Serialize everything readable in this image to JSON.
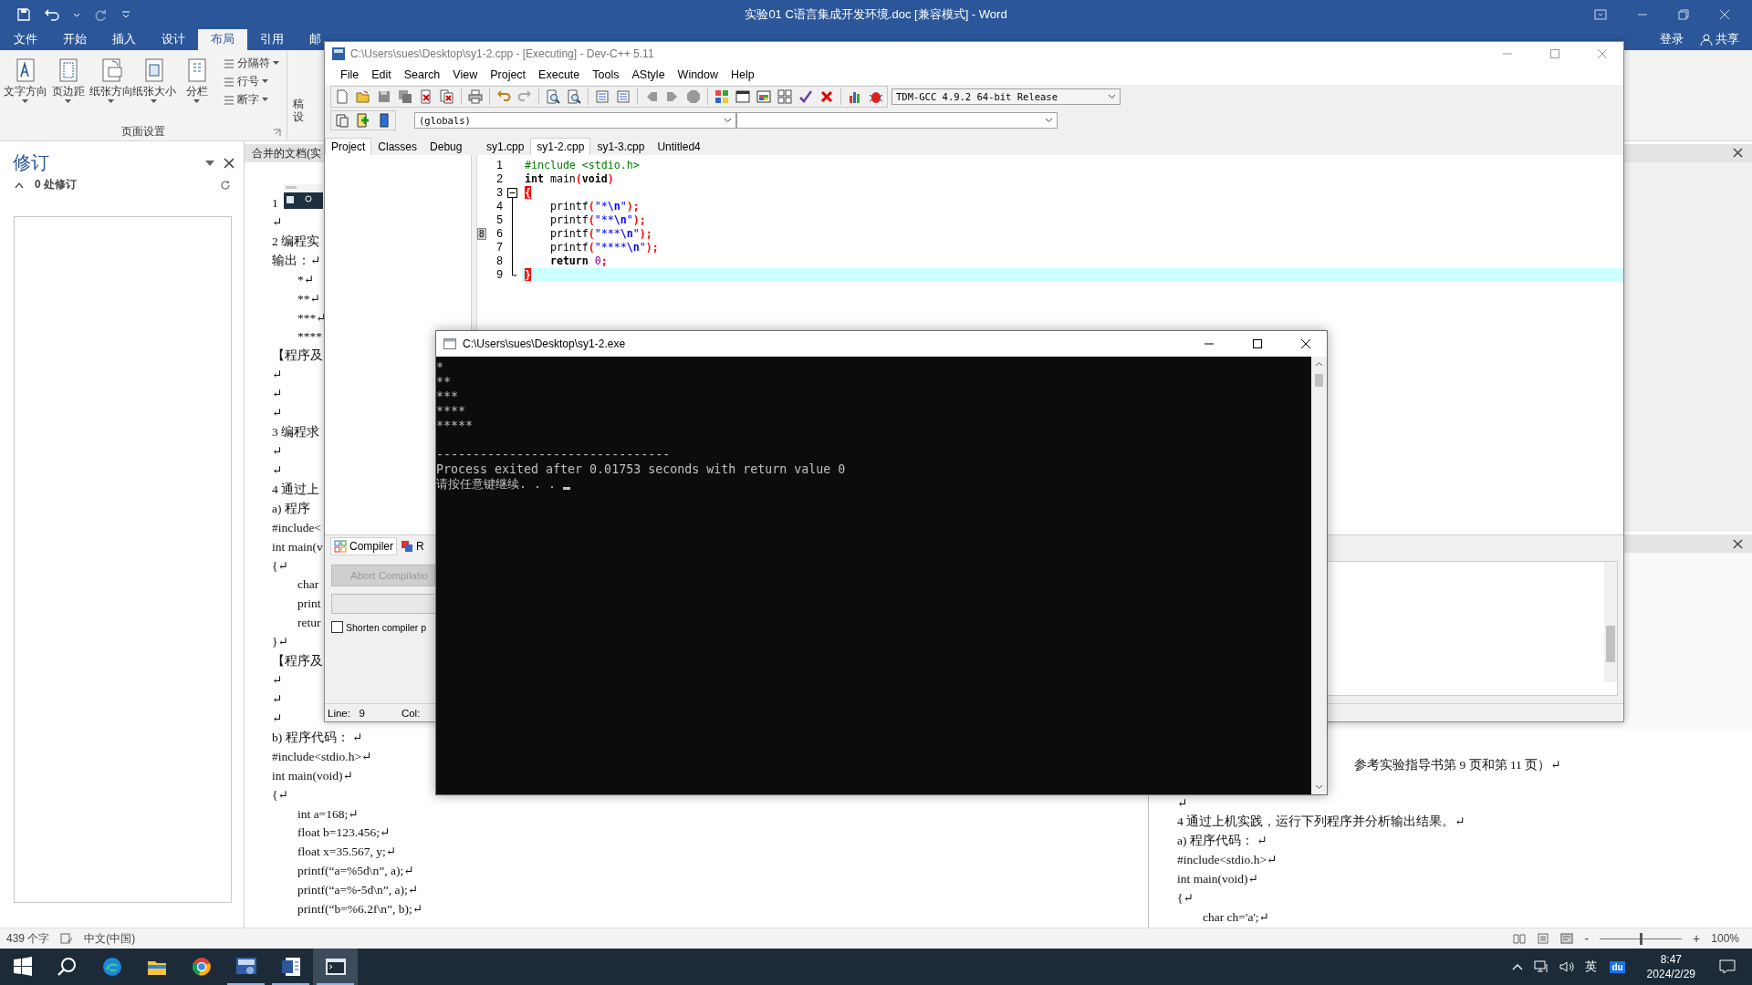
{
  "word": {
    "title": "实验01 C语言集成开发环境.doc [兼容模式] - Word",
    "ribbon_tabs": [
      {
        "label": "文件",
        "selected": false
      },
      {
        "label": "开始",
        "selected": false
      },
      {
        "label": "插入",
        "selected": false
      },
      {
        "label": "设计",
        "selected": false
      },
      {
        "label": "布局",
        "selected": true
      },
      {
        "label": "引用",
        "selected": false
      },
      {
        "label": "邮",
        "selected": false
      }
    ],
    "sign_in": "登录",
    "share": "共享",
    "large_buttons": [
      "文字方向",
      "页边距",
      "纸张方向",
      "纸张大小",
      "分栏"
    ],
    "small_buttons": [
      "分隔符",
      "行号",
      "断字"
    ],
    "group_label": "页面设置",
    "cut_labels": [
      "稿",
      "设"
    ],
    "revisions": {
      "title": "修订",
      "count": "0 处修订"
    },
    "doc_tab": "合并的文档(实",
    "left_lines": [
      {
        "text": "1",
        "indent": false
      },
      {
        "text": "↵",
        "indent": false
      },
      {
        "text": "2 编程实",
        "indent": false
      },
      {
        "text": "输出：↵",
        "indent": false
      },
      {
        "text": "*↵",
        "indent": true
      },
      {
        "text": "**↵",
        "indent": true
      },
      {
        "text": "***↵",
        "indent": true
      },
      {
        "text": "****",
        "indent": true
      },
      {
        "text": "【程序及",
        "indent": false
      },
      {
        "text": "↵",
        "indent": false
      },
      {
        "text": "↵",
        "indent": false
      },
      {
        "text": "↵",
        "indent": false
      },
      {
        "text": "3 编程求",
        "indent": false
      },
      {
        "text": "↵",
        "indent": false
      },
      {
        "text": "↵",
        "indent": false
      },
      {
        "text": "4 通过上",
        "indent": false
      },
      {
        "text": "a)  程序",
        "indent": false
      },
      {
        "text": "#include<",
        "indent": false
      },
      {
        "text": "int main(v",
        "indent": false
      },
      {
        "text": "{↵",
        "indent": false
      },
      {
        "text": "char",
        "indent": true
      },
      {
        "text": "print",
        "indent": true
      },
      {
        "text": "retur",
        "indent": true
      },
      {
        "text": "}↵",
        "indent": false
      },
      {
        "text": "【程序及",
        "indent": false
      },
      {
        "text": "↵",
        "indent": false
      },
      {
        "text": "↵",
        "indent": false
      },
      {
        "text": "↵",
        "indent": false
      },
      {
        "text": "b)    程序代码：  ↵",
        "indent": false
      },
      {
        "text": "#include<stdio.h>↵",
        "indent": false
      },
      {
        "text": "int main(void)↵",
        "indent": false
      },
      {
        "text": "{↵",
        "indent": false
      },
      {
        "text": "int a=168;↵",
        "indent": true
      },
      {
        "text": "float b=123.456;↵",
        "indent": true
      },
      {
        "text": "float x=35.567, y;↵",
        "indent": true
      },
      {
        "text": "printf(“a=%5d\\n”, a);↵",
        "indent": true
      },
      {
        "text": "printf(“a=%-5d\\n”, a);↵",
        "indent": true
      },
      {
        "text": "printf(“b=%6.2f\\n”, b);↵",
        "indent": true
      }
    ],
    "right_partial_line": "参考实验指导书第 9 页和第 11 页）↵",
    "right_lines": [
      {
        "text": "↵",
        "indent": false
      },
      {
        "text": "4 通过上机实践，运行下列程序并分析输出结果。↵",
        "indent": false
      },
      {
        "text": "a)    程序代码：  ↵",
        "indent": false
      },
      {
        "text": "#include<stdio.h>↵",
        "indent": false
      },
      {
        "text": "int main(void)↵",
        "indent": false
      },
      {
        "text": "{↵",
        "indent": false
      },
      {
        "text": "char ch='a';↵",
        "indent": true
      }
    ],
    "status": {
      "words": "439 个字",
      "language": "中文(中国)",
      "zoom_out": "-",
      "zoom_in": "+",
      "zoom": "100%",
      "level": 0.5
    }
  },
  "devcpp": {
    "title": "C:\\Users\\sues\\Desktop\\sy1-2.cpp - [Executing] - Dev-C++ 5.11",
    "menu": [
      "File",
      "Edit",
      "Search",
      "View",
      "Project",
      "Execute",
      "Tools",
      "AStyle",
      "Window",
      "Help"
    ],
    "compiler": "TDM-GCC 4.9.2 64-bit Release",
    "scope": "(globals)",
    "panel_tabs": [
      {
        "label": "Project",
        "selected": true
      },
      {
        "label": "Classes",
        "selected": false
      },
      {
        "label": "Debug",
        "selected": false
      }
    ],
    "file_tabs": [
      {
        "label": "sy1.cpp",
        "selected": false
      },
      {
        "label": "sy1-2.cpp",
        "selected": true
      },
      {
        "label": "sy1-3.cpp",
        "selected": false
      },
      {
        "label": "Untitled4",
        "selected": false
      }
    ],
    "code": [
      {
        "number": "1",
        "current": false,
        "kind": "plain",
        "tokens": [
          {
            "kind": "preprocessor",
            "text": "#include <stdio.h>"
          }
        ]
      },
      {
        "number": "2",
        "current": false,
        "kind": "plain",
        "tokens": [
          {
            "kind": "keyword",
            "text": "int"
          },
          {
            "kind": "plain",
            "text": " main"
          },
          {
            "kind": "symbol",
            "text": "("
          },
          {
            "kind": "keyword",
            "text": "void"
          },
          {
            "kind": "symbol",
            "text": ")"
          }
        ]
      },
      {
        "number": "3",
        "current": false,
        "kind": "fold-start",
        "tokens": [
          {
            "kind": "match",
            "text": "{"
          }
        ]
      },
      {
        "number": "4",
        "current": false,
        "kind": "fold-line",
        "tokens": [
          {
            "kind": "plain",
            "text": "    printf"
          },
          {
            "kind": "symbol",
            "text": "("
          },
          {
            "kind": "string",
            "text": "\"*"
          },
          {
            "kind": "escape",
            "text": "\\n"
          },
          {
            "kind": "string",
            "text": "\""
          },
          {
            "kind": "symbol",
            "text": ");"
          }
        ]
      },
      {
        "number": "5",
        "current": false,
        "kind": "fold-line",
        "tokens": [
          {
            "kind": "plain",
            "text": "    printf"
          },
          {
            "kind": "symbol",
            "text": "("
          },
          {
            "kind": "string",
            "text": "\"**"
          },
          {
            "kind": "escape",
            "text": "\\n"
          },
          {
            "kind": "string",
            "text": "\""
          },
          {
            "kind": "symbol",
            "text": ");"
          }
        ]
      },
      {
        "number": "6",
        "current": false,
        "bookmark": "8",
        "kind": "fold-line",
        "tokens": [
          {
            "kind": "plain",
            "text": "    printf"
          },
          {
            "kind": "symbol",
            "text": "("
          },
          {
            "kind": "string",
            "text": "\"***"
          },
          {
            "kind": "escape",
            "text": "\\n"
          },
          {
            "kind": "string",
            "text": "\""
          },
          {
            "kind": "symbol",
            "text": ");"
          }
        ]
      },
      {
        "number": "7",
        "current": false,
        "kind": "fold-line",
        "tokens": [
          {
            "kind": "plain",
            "text": "    printf"
          },
          {
            "kind": "symbol",
            "text": "("
          },
          {
            "kind": "string",
            "text": "\"****"
          },
          {
            "kind": "escape",
            "text": "\\n"
          },
          {
            "kind": "string",
            "text": "\""
          },
          {
            "kind": "symbol",
            "text": ");"
          }
        ]
      },
      {
        "number": "8",
        "current": false,
        "kind": "fold-line",
        "tokens": [
          {
            "kind": "keyword",
            "text": "    return"
          },
          {
            "kind": "number",
            "text": " 0"
          },
          {
            "kind": "symbol",
            "text": ";"
          }
        ]
      },
      {
        "number": "9",
        "current": true,
        "kind": "fold-end",
        "tokens": [
          {
            "kind": "match",
            "text": "}"
          }
        ]
      }
    ],
    "bottom_tabs": [
      {
        "label": "Compiler",
        "selected": true
      },
      {
        "label": "R",
        "selected": false
      }
    ],
    "abort_button": {
      "label": "Abort Compilatio",
      "disabled": true
    },
    "shorten_checkbox": {
      "label": "Shorten compiler p",
      "checked": false
    },
    "status": {
      "line_label": "Line:",
      "line": "9",
      "col_label": "Col:"
    }
  },
  "console": {
    "title": "C:\\Users\\sues\\Desktop\\sy1-2.exe",
    "output_lines": [
      "*",
      "**",
      "***",
      "****",
      "*****"
    ],
    "separator": "--------------------------------",
    "message": "Process exited after 0.01753 seconds with return value 0",
    "prompt": "请按任意键继续. . . ",
    "cursor": true
  },
  "taskbar": {
    "apps": [
      {
        "kind": "start",
        "running": false,
        "selected": false
      },
      {
        "kind": "search",
        "running": false,
        "selected": false
      },
      {
        "kind": "edge",
        "running": false,
        "selected": false
      },
      {
        "kind": "explorer",
        "running": false,
        "selected": false
      },
      {
        "kind": "chrome",
        "running": false,
        "selected": false
      },
      {
        "kind": "ide",
        "running": true,
        "selected": false
      },
      {
        "kind": "word",
        "running": true,
        "selected": false
      },
      {
        "kind": "console",
        "running": true,
        "selected": true
      }
    ],
    "language": "英",
    "ime": "du",
    "time": "8:47",
    "date": "2024/2/29"
  }
}
